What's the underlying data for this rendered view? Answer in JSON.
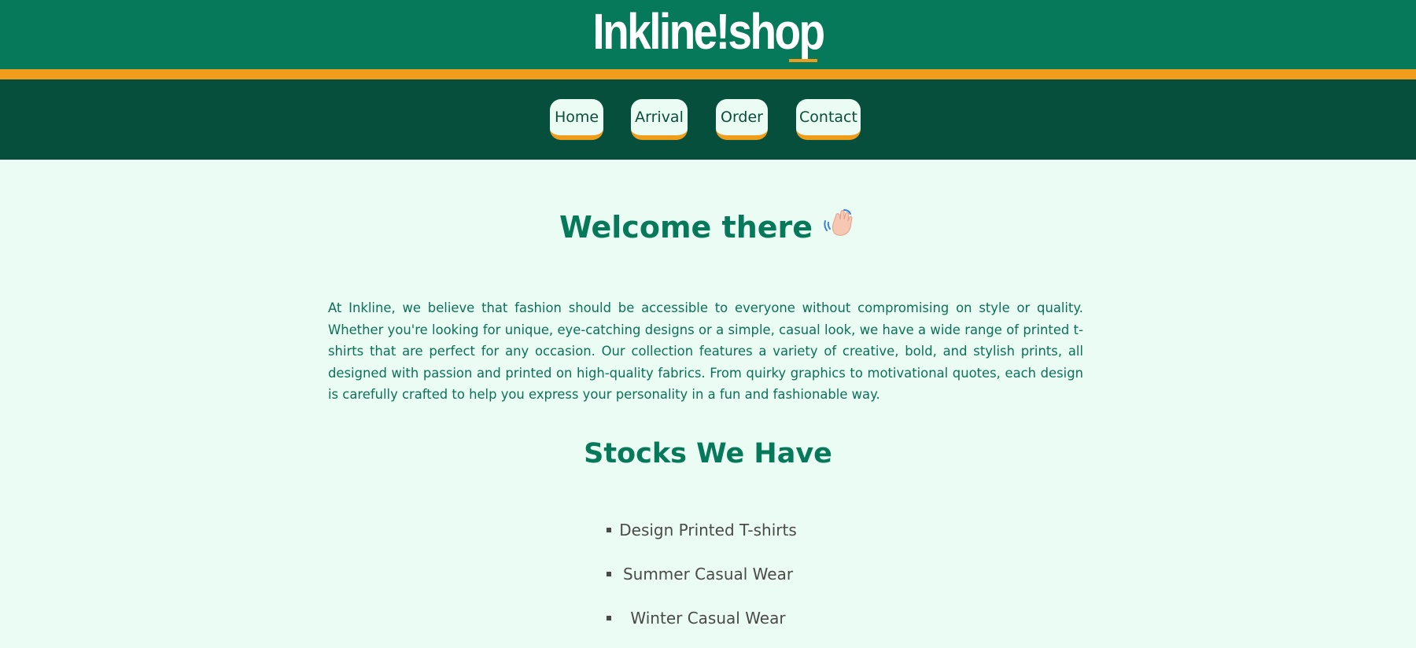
{
  "brand": {
    "logo_text": "Inkline!shop"
  },
  "nav": {
    "items": [
      {
        "label": "Home"
      },
      {
        "label": "Arrival"
      },
      {
        "label": "Order"
      },
      {
        "label": "Contact"
      }
    ]
  },
  "main": {
    "welcome_title": "Welcome there",
    "welcome_icon": "waving-hand-icon",
    "intro_text": "At Inkline, we believe that fashion should be accessible to everyone without compromising on style or quality. Whether you're looking for unique, eye-catching designs or a simple, casual look, we have a wide range of printed t-shirts that are perfect for any occasion. Our collection features a variety of creative, bold, and stylish prints, all designed with passion and printed on high-quality fabrics. From quirky graphics to motivational quotes, each design is carefully crafted to help you express your personality in a fun and fashionable way.",
    "stocks_title": "Stocks We Have",
    "stocks": [
      "Design Printed T-shirts",
      "Summer Casual Wear",
      "Winter Casual Wear"
    ]
  },
  "colors": {
    "header_green": "#06795a",
    "nav_dark_green": "#054f3c",
    "accent_orange": "#f09d1c",
    "page_background": "#eafcf3",
    "text_green": "#06795a",
    "list_text": "#4a4a4a"
  }
}
